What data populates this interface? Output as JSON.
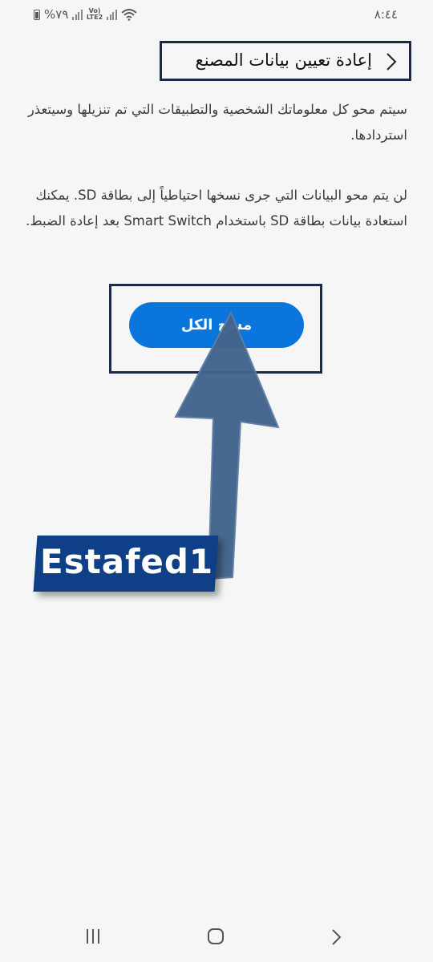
{
  "status_bar": {
    "battery": "%٧٩",
    "network": "Vo)) LTE2",
    "time": "٨:٤٤"
  },
  "header": {
    "title": "إعادة تعيين بيانات المصنع",
    "back_icon": "chevron-icon"
  },
  "content": {
    "paragraph1": "سيتم محو كل معلوماتك الشخصية والتطبيقات التي تم تنزيلها وسيتعذر استردادها.",
    "paragraph2": "لن يتم محو البيانات التي جرى نسخها احتياطياً إلى بطاقة SD. يمكنك استعادة بيانات بطاقة SD باستخدام Smart Switch بعد إعادة الضبط."
  },
  "erase_button": {
    "label": "مسح الكل",
    "color": "#0a76dd"
  },
  "watermark": {
    "text": "Estafed1"
  },
  "nav_bar": {
    "icons": [
      "recents-icon",
      "home-icon",
      "back-icon"
    ]
  },
  "colors": {
    "highlight_border": "#1a2a47",
    "arrow": "#42648c",
    "background": "#f6f6f6"
  }
}
